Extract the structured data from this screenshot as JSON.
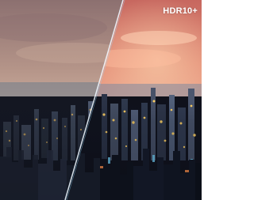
{
  "badge": {
    "label": "HDR10+"
  },
  "comparison": {
    "left_panel": "standard-city-photo",
    "right_panel": "hdr-enhanced-city-photo"
  },
  "colors": {
    "left_sky_top": "#a4837f",
    "left_sky_bottom": "#d8b8a6",
    "right_sky_top": "#d9726d",
    "right_sky_bottom": "#f2b49a",
    "divider": "#eaf6ff",
    "city_glow": "#ffb347"
  }
}
